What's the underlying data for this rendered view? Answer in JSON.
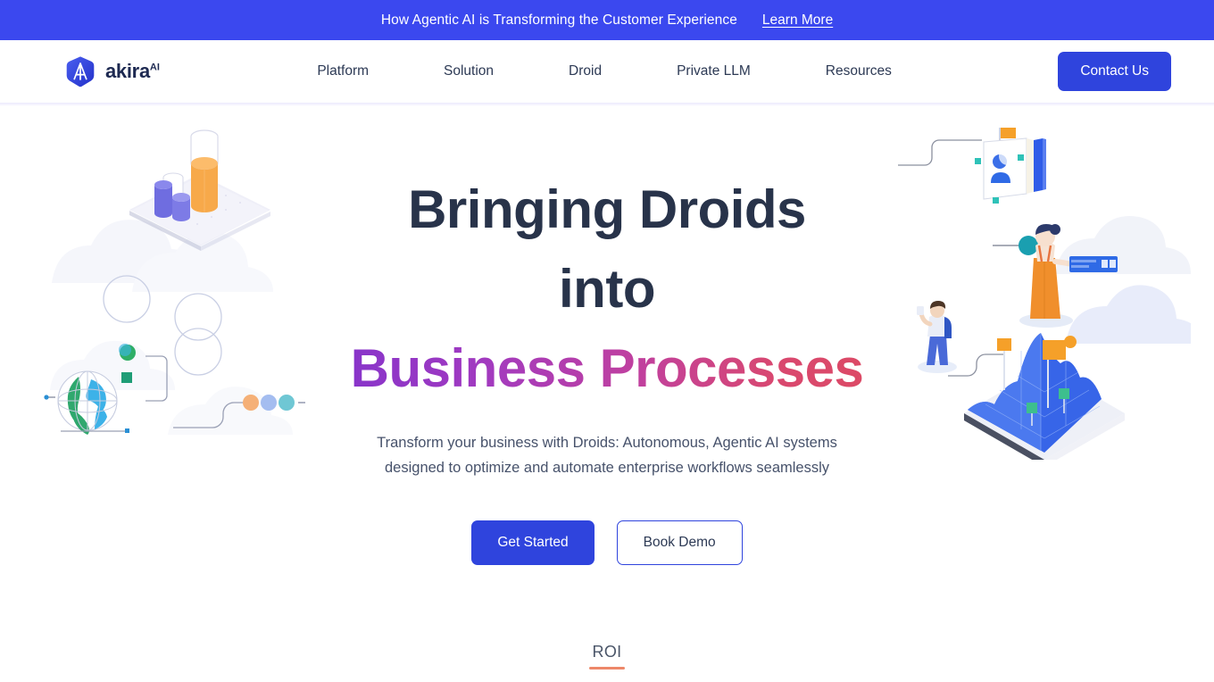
{
  "announcement": {
    "text": "How Agentic AI is Transforming the Customer Experience",
    "link_label": "Learn More",
    "bg_color": "#3B48EF"
  },
  "header": {
    "brand": {
      "name": "akira",
      "superscript": "AI",
      "logo_icon": "akira-hexagon-logo-icon",
      "logo_color": "#2f44dd",
      "wordmark_color": "#1d2951"
    },
    "nav_items": [
      {
        "label": "Platform"
      },
      {
        "label": "Solution"
      },
      {
        "label": "Droid"
      },
      {
        "label": "Private LLM"
      },
      {
        "label": "Resources"
      }
    ],
    "contact_button": {
      "label": "Contact Us",
      "bg_color": "#2f44dd"
    }
  },
  "hero": {
    "headline_line1": "Bringing Droids",
    "headline_line2": "into",
    "headline_accent": "Business Processes",
    "headline_color": "#28334a",
    "accent_gradient_from": "#8333cc",
    "accent_gradient_to": "#dd4a63",
    "subheadline_line1": "Transform your business with Droids: Autonomous, Agentic AI systems",
    "subheadline_line2": "designed to optimize and automate enterprise workflows seamlessly",
    "primary_cta": "Get Started",
    "secondary_cta": "Book Demo",
    "illustration_left": "isometric-data-chart-globe-illustration",
    "illustration_right": "isometric-terrain-people-card-illustration"
  },
  "roi_section": {
    "label": "ROI",
    "underline_color": "#ed8869"
  }
}
